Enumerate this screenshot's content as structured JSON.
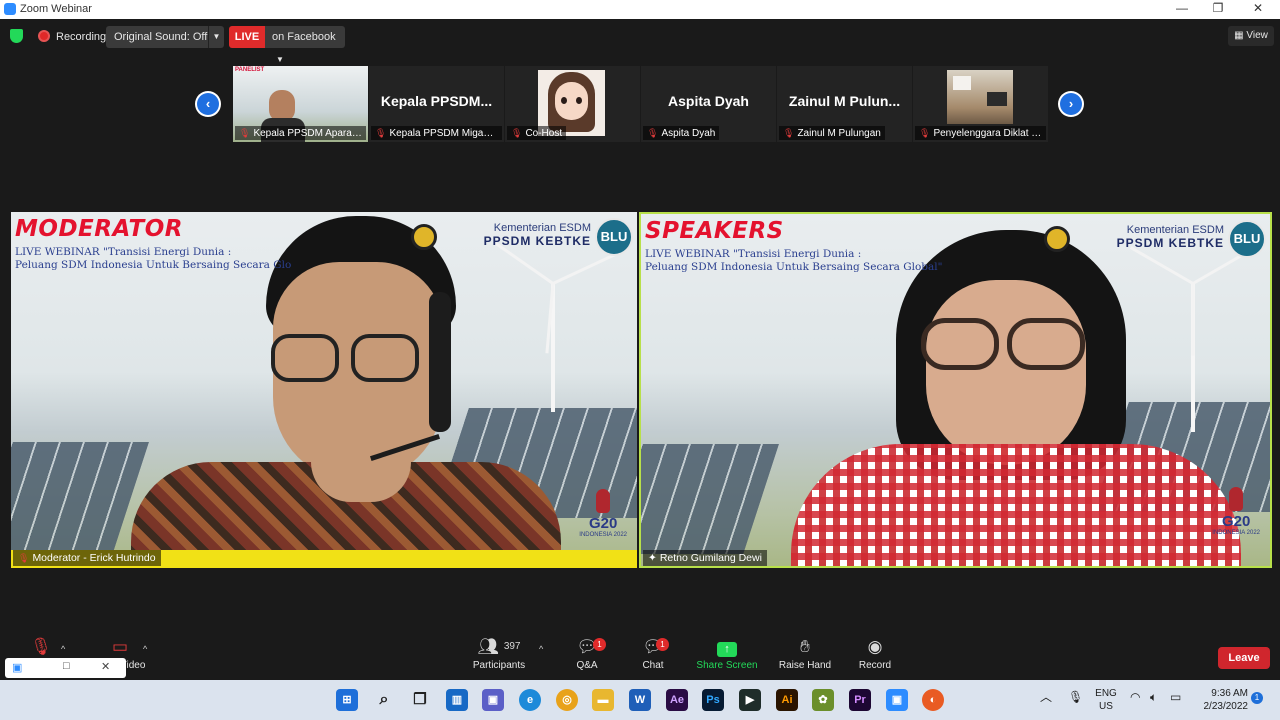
{
  "window": {
    "title": "Zoom Webinar",
    "controls": [
      "—",
      "❐",
      "✕"
    ]
  },
  "topbar": {
    "recording_label": "Recording",
    "original_sound_label": "Original Sound: Off",
    "live_label": "LIVE",
    "live_target": "on Facebook",
    "view_label": "View"
  },
  "gallery": {
    "thumbs": [
      {
        "type": "video",
        "caption": "Kepala PPSDM Aparat...",
        "overlay": "PANELIST"
      },
      {
        "type": "name",
        "big": "Kepala  PPSDM...",
        "caption": "Kepala PPSDM Migas -..."
      },
      {
        "type": "avatar",
        "caption": "Co-Host"
      },
      {
        "type": "name",
        "big": "Aspita Dyah",
        "caption": "Aspita Dyah"
      },
      {
        "type": "name",
        "big": "Zainul M Pulun...",
        "caption": "Zainul M Pulungan"
      },
      {
        "type": "room",
        "caption": "Penyelenggara Diklat P..."
      }
    ]
  },
  "tiles": {
    "moderator": {
      "banner": "MODERATOR",
      "line1": "LIVE WEBINAR \"Transisi Energi Dunia :",
      "line2": "Peluang SDM Indonesia Untuk Bersaing Secara Glo",
      "org1": "Kementerian ESDM",
      "org2": "PPSDM KEBTKE",
      "blu": "BLU",
      "g20": "G20",
      "g20_sub": "INDONESIA 2022",
      "name": "Moderator - Erick Hutrindo"
    },
    "speaker": {
      "banner": "SPEAKERS",
      "line1": "LIVE WEBINAR \"Transisi Energi Dunia :",
      "line2": "Peluang SDM Indonesia Untuk Bersaing Secara Global\"",
      "org1": "Kementerian ESDM",
      "org2": "PPSDM KEBTKE",
      "blu": "BLU",
      "g20": "G20",
      "g20_sub": "INDONESIA 2022",
      "name": "Retno Gumilang Dewi"
    }
  },
  "toolbar": {
    "video_label": "Video",
    "participants_label": "Participants",
    "participants_count": "397",
    "qa_label": "Q&A",
    "qa_badge": "1",
    "chat_label": "Chat",
    "chat_badge": "1",
    "share_label": "Share Screen",
    "raise_label": "Raise Hand",
    "record_label": "Record",
    "leave_label": "Leave"
  },
  "taskbar": {
    "lang1": "ENG",
    "lang2": "US",
    "time": "9:36 AM",
    "date": "2/23/2022",
    "notif": "1"
  },
  "colors": {
    "accent_green": "#23d959",
    "live_red": "#e02b2b",
    "share_green": "#23d959",
    "leave_red": "#d0262d"
  }
}
